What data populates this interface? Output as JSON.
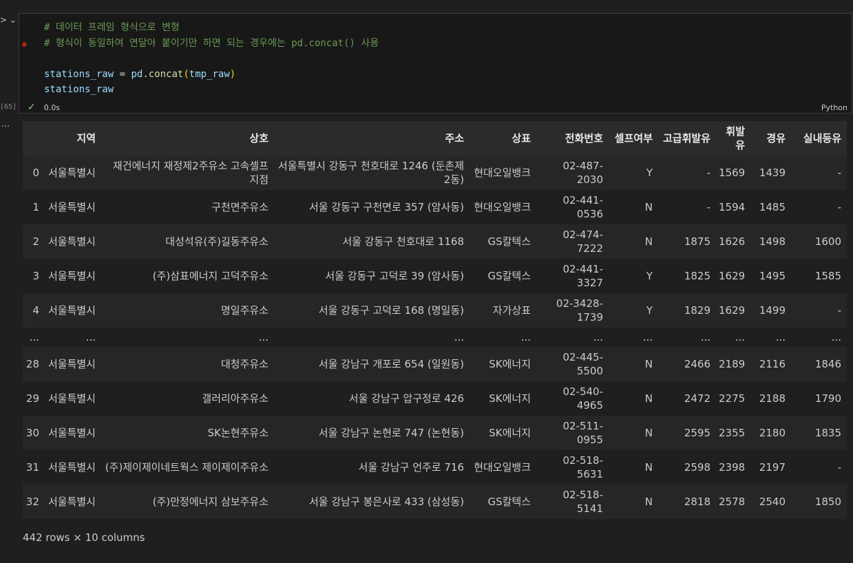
{
  "cell": {
    "execution_count": "[65]",
    "code": {
      "comment1": "# 데이터 프레임 형식으로 변형",
      "comment2": "# 형식이 동일하여 연달아 붙이기만 하면 되는 경우에는 pd.concat() 사용",
      "line3": {
        "var": "stations_raw",
        "eq": " = ",
        "mod": "pd",
        "dot": ".",
        "func": "concat",
        "open": "(",
        "arg": "tmp_raw",
        "close": ")"
      },
      "line4": "stations_raw"
    },
    "status_check": "✓",
    "duration": "0.0s",
    "language": "Python"
  },
  "table": {
    "columns": [
      "지역",
      "상호",
      "주소",
      "상표",
      "전화번호",
      "셀프여부",
      "고급휘발유",
      "휘발유",
      "경유",
      "실내등유"
    ],
    "rows": [
      {
        "index": "0",
        "cells": [
          "서울특별시",
          "재건에너지 재정제2주유소 고속셀프지점",
          "서울특별시 강동구 천호대로 1246 (둔촌제2동)",
          "현대오일뱅크",
          "02-487-2030",
          "Y",
          "-",
          "1569",
          "1439",
          "-"
        ]
      },
      {
        "index": "1",
        "cells": [
          "서울특별시",
          "구천면주유소",
          "서울 강동구 구천면로 357 (암사동)",
          "현대오일뱅크",
          "02-441-0536",
          "N",
          "-",
          "1594",
          "1485",
          "-"
        ]
      },
      {
        "index": "2",
        "cells": [
          "서울특별시",
          "대성석유(주)길동주유소",
          "서울 강동구 천호대로 1168",
          "GS칼텍스",
          "02-474-7222",
          "N",
          "1875",
          "1626",
          "1498",
          "1600"
        ]
      },
      {
        "index": "3",
        "cells": [
          "서울특별시",
          "(주)삼표에너지 고덕주유소",
          "서울 강동구 고덕로 39 (암사동)",
          "GS칼텍스",
          "02-441-3327",
          "Y",
          "1825",
          "1629",
          "1495",
          "1585"
        ]
      },
      {
        "index": "4",
        "cells": [
          "서울특별시",
          "명일주유소",
          "서울 강동구 고덕로 168 (명일동)",
          "자가상표",
          "02-3428-1739",
          "Y",
          "1829",
          "1629",
          "1499",
          "-"
        ]
      },
      {
        "index": "...",
        "cells": [
          "...",
          "...",
          "...",
          "...",
          "...",
          "...",
          "...",
          "...",
          "...",
          "..."
        ],
        "ellipsis": true
      },
      {
        "index": "28",
        "cells": [
          "서울특별시",
          "대청주유소",
          "서울 강남구 개포로 654 (일원동)",
          "SK에너지",
          "02-445-5500",
          "N",
          "2466",
          "2189",
          "2116",
          "1846"
        ]
      },
      {
        "index": "29",
        "cells": [
          "서울특별시",
          "갤러리아주유소",
          "서울 강남구 압구정로 426",
          "SK에너지",
          "02-540-4965",
          "N",
          "2472",
          "2275",
          "2188",
          "1790"
        ]
      },
      {
        "index": "30",
        "cells": [
          "서울특별시",
          "SK논현주유소",
          "서울 강남구 논현로 747 (논현동)",
          "SK에너지",
          "02-511-0955",
          "N",
          "2595",
          "2355",
          "2180",
          "1835"
        ]
      },
      {
        "index": "31",
        "cells": [
          "서울특별시",
          "(주)제이제이네트웍스 제이제이주유소",
          "서울 강남구 언주로 716",
          "현대오일뱅크",
          "02-518-5631",
          "N",
          "2598",
          "2398",
          "2197",
          "-"
        ]
      },
      {
        "index": "32",
        "cells": [
          "서울특별시",
          "(주)만정에너지 삼보주유소",
          "서울 강남구 봉은사로 433 (삼성동)",
          "GS칼텍스",
          "02-518-5141",
          "N",
          "2818",
          "2578",
          "2540",
          "1850"
        ]
      }
    ],
    "footer": "442 rows × 10 columns"
  }
}
